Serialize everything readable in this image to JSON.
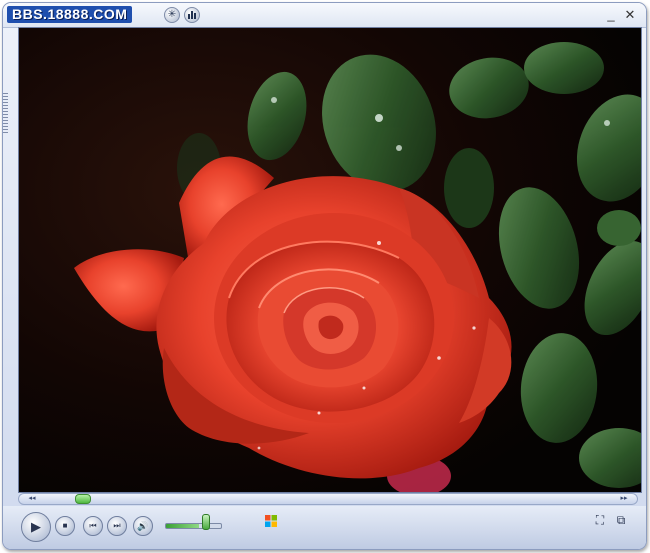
{
  "window": {
    "watermark": "BBS.18888.COM",
    "minimize_glyph": "_",
    "close_glyph": "✕"
  },
  "titlebar_icons": [
    "star-burst-icon",
    "equalizer-icon"
  ],
  "video": {
    "content": "red-rose-photo",
    "colors": {
      "petal": "#e8422c",
      "petal_dark": "#a61b10",
      "leaf": "#2f5a2a",
      "background": "#0d0402"
    }
  },
  "seekbar": {
    "left_glyph": "◂◂",
    "right_glyph": "▸▸",
    "position_fraction": 0.06
  },
  "controls": {
    "play_glyph": "▶",
    "stop_glyph": "■",
    "previous_glyph": "⏮",
    "next_glyph": "⏭",
    "mute_glyph": "🔊",
    "volume_fraction": 0.75,
    "fullscreen_glyph": "⛶",
    "switch_mode_glyph": "⧉"
  },
  "colors": {
    "accent": "#1f4fae",
    "seek_green": "#4fb840",
    "frame": "#cfd9ee"
  }
}
